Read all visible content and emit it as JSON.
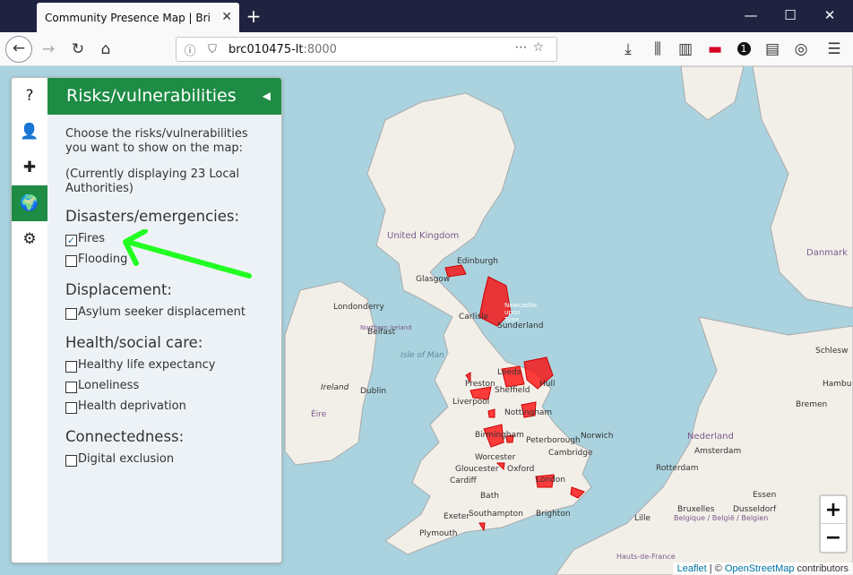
{
  "browser": {
    "tab_title": "Community Presence Map | British",
    "tab_close": "✕",
    "new_tab": "+",
    "url_host": "brc010475-lt",
    "url_port": ":8000",
    "window_controls": {
      "minimize": "—",
      "maximize": "☐",
      "close": "✕"
    }
  },
  "sidebar": {
    "tabs": [
      {
        "icon": "help-icon",
        "glyph": "?"
      },
      {
        "icon": "user-icon",
        "glyph": "👤"
      },
      {
        "icon": "first-aid-icon",
        "glyph": "✚"
      },
      {
        "icon": "globe-icon",
        "glyph": "🌍",
        "active": true
      },
      {
        "icon": "gear-icon",
        "glyph": "⚙"
      }
    ],
    "pane": {
      "title": "Risks/vulnerabilities",
      "close_glyph": "◀",
      "intro": "Choose the risks/vulnerabilities you want to show on the map:",
      "status": "(Currently displaying 23 Local Authorities)",
      "sections": [
        {
          "title": "Disasters/emergencies:",
          "items": [
            {
              "label": "Fires",
              "checked": true
            },
            {
              "label": "Flooding",
              "checked": false
            }
          ]
        },
        {
          "title": "Displacement:",
          "items": [
            {
              "label": "Asylum seeker displacement",
              "checked": false
            }
          ]
        },
        {
          "title": "Health/social care:",
          "items": [
            {
              "label": "Healthy life expectancy",
              "checked": false
            },
            {
              "label": "Loneliness",
              "checked": false
            },
            {
              "label": "Health deprivation",
              "checked": false
            }
          ]
        },
        {
          "title": "Connectedness:",
          "items": [
            {
              "label": "Digital exclusion",
              "checked": false
            }
          ]
        }
      ]
    }
  },
  "map": {
    "labels": {
      "united_kingdom": "United Kingdom",
      "edinburgh": "Edinburgh",
      "glasgow": "Glasgow",
      "newcastle": "Newcastle upon Tyne",
      "carlisle": "Carlisle",
      "sunderland": "Sunderland",
      "isle_of_man": "Isle of Man",
      "preston": "Preston",
      "leeds": "Leeds",
      "hull": "Hull",
      "liverpool": "Liverpool",
      "sheffield": "Sheffield",
      "nottingham": "Nottingham",
      "birmingham": "Birmingham",
      "norwich": "Norwich",
      "peterborough": "Peterborough",
      "cambridge": "Cambridge",
      "worcester": "Worcester",
      "gloucester": "Gloucester",
      "oxford": "Oxford",
      "cardiff": "Cardiff",
      "london": "London",
      "bath": "Bath",
      "exeter": "Exeter",
      "southampton": "Southampton",
      "brighton": "Brighton",
      "plymouth": "Plymouth",
      "ireland": "Ireland",
      "ireland_ga": "Éire",
      "dublin": "Dublin",
      "belfast": "Belfast",
      "londonderry": "Londonderry",
      "northern_ireland": "Northern Ireland",
      "danmark": "Danmark",
      "hamburg": "Hambu",
      "bremen": "Bremen",
      "nederland": "Nederland",
      "amsterdam": "Amsterdam",
      "rotterdam": "Rotterdam",
      "essen": "Essen",
      "duesseldorf": "Dusseldorf",
      "lille": "Lille",
      "belgique": "Belgique / België / Belgien",
      "bruxelles": "Bruxelles",
      "hauts_de_france": "Hauts-de-France",
      "schleswig": "Schlesw"
    },
    "zoom_in": "+",
    "zoom_out": "−",
    "attribution": {
      "leaflet": "Leaflet",
      "sep": " | © ",
      "osm": "OpenStreetMap",
      "contrib": " contributors"
    }
  }
}
